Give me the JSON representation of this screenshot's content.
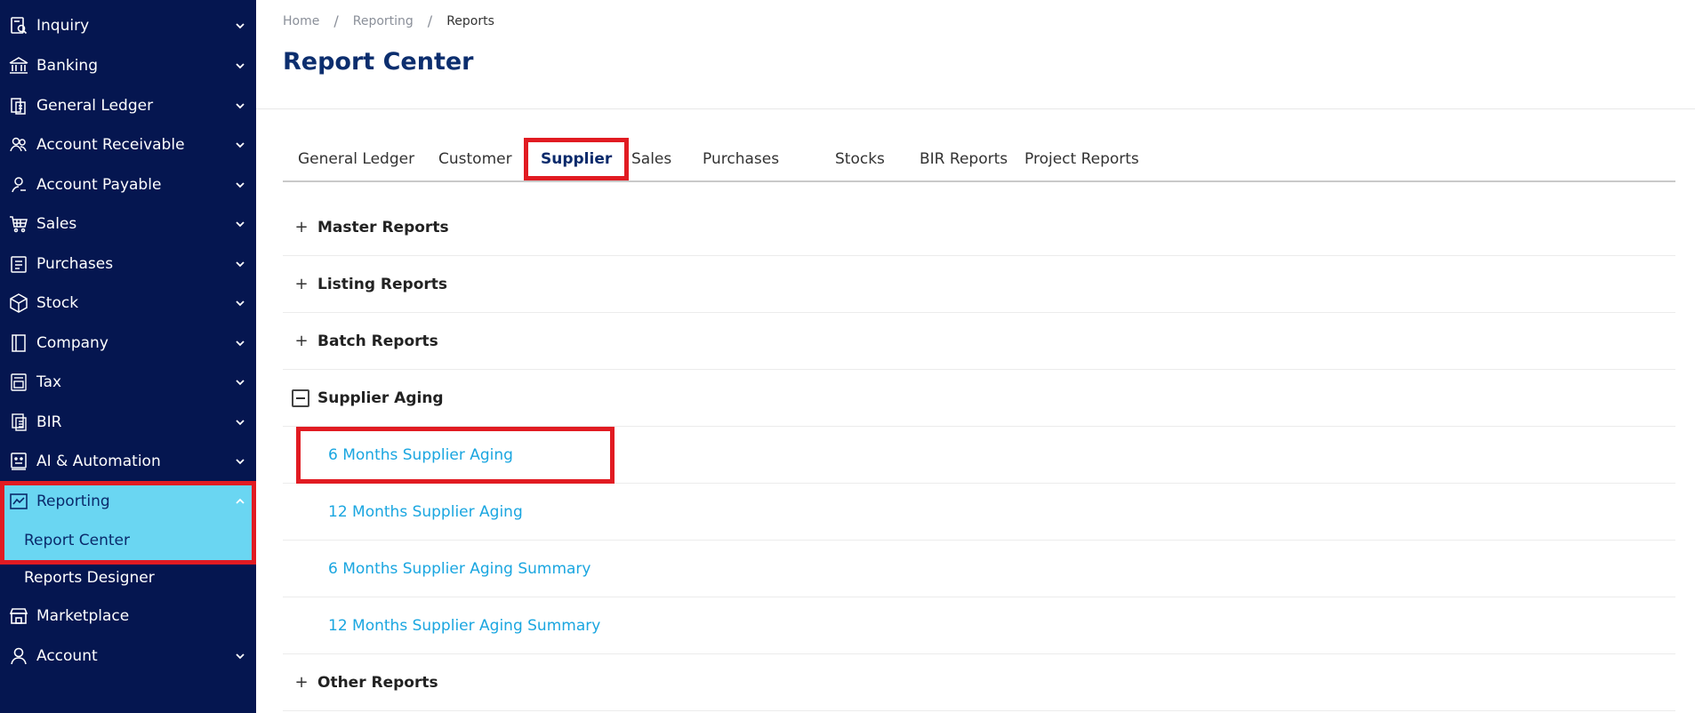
{
  "sidebar": {
    "items": [
      {
        "label": "Inquiry",
        "icon": "inquiry-icon"
      },
      {
        "label": "Banking",
        "icon": "bank-icon"
      },
      {
        "label": "General Ledger",
        "icon": "ledger-icon"
      },
      {
        "label": "Account Receivable",
        "icon": "receivable-icon"
      },
      {
        "label": "Account Payable",
        "icon": "payable-icon"
      },
      {
        "label": "Sales",
        "icon": "cart-icon"
      },
      {
        "label": "Purchases",
        "icon": "purchases-icon"
      },
      {
        "label": "Stock",
        "icon": "box-icon"
      },
      {
        "label": "Company",
        "icon": "company-icon"
      },
      {
        "label": "Tax",
        "icon": "tax-icon"
      },
      {
        "label": "BIR",
        "icon": "bir-icon"
      },
      {
        "label": "AI & Automation",
        "icon": "robot-icon"
      },
      {
        "label": "Reporting",
        "icon": "chart-icon"
      },
      {
        "label": "Marketplace",
        "icon": "store-icon"
      },
      {
        "label": "Account",
        "icon": "user-icon"
      }
    ],
    "sub_items": {
      "report_center": "Report Center",
      "reports_designer": "Reports Designer"
    }
  },
  "breadcrumb": {
    "home": "Home",
    "reporting": "Reporting",
    "current": "Reports",
    "separator": "/"
  },
  "page_title": "Report Center",
  "tabs": [
    "General Ledger",
    "Customer",
    "Supplier",
    "Sales",
    "Purchases",
    "Stocks",
    "BIR Reports",
    "Project Reports"
  ],
  "active_tab": "Supplier",
  "sections": {
    "master": "Master Reports",
    "listing": "Listing Reports",
    "batch": "Batch Reports",
    "supplier_aging": "Supplier Aging",
    "other": "Other Reports"
  },
  "supplier_aging_links": [
    "6 Months Supplier Aging",
    "12 Months Supplier Aging",
    "6 Months Supplier Aging Summary",
    "12 Months Supplier Aging Summary"
  ],
  "toggles": {
    "expand": "+"
  },
  "colors": {
    "sidebar_bg": "#051650",
    "active_bg": "#6ad6f2",
    "highlight": "#e11b22",
    "link": "#1aa6e0",
    "title": "#0c2e6e"
  }
}
